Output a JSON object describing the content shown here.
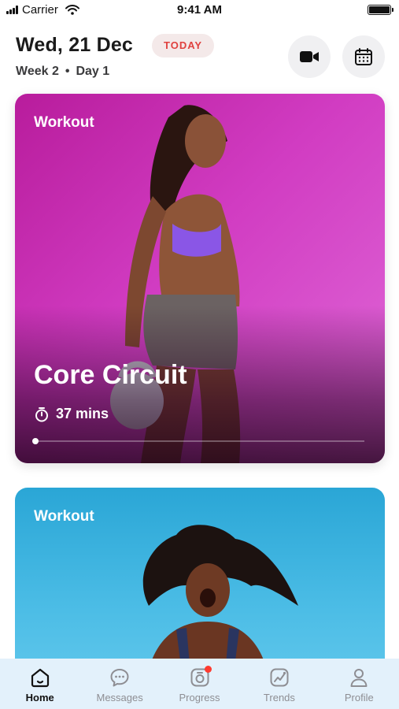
{
  "status_bar": {
    "carrier": "Carrier",
    "time": "9:41 AM"
  },
  "header": {
    "date": "Wed, 21 Dec",
    "badge": "TODAY",
    "week": "Week 2",
    "separator": "•",
    "day": "Day 1",
    "icons": [
      "video-camera-icon",
      "calendar-icon"
    ]
  },
  "cards": [
    {
      "category": "Workout",
      "title": "Core Circuit",
      "duration": "37 mins",
      "progress": 0.0
    },
    {
      "category": "Workout"
    }
  ],
  "tabs": [
    {
      "label": "Home",
      "icon": "home-icon",
      "active": true
    },
    {
      "label": "Messages",
      "icon": "messages-icon"
    },
    {
      "label": "Progress",
      "icon": "progress-icon",
      "has_notification": true
    },
    {
      "label": "Trends",
      "icon": "trends-icon"
    },
    {
      "label": "Profile",
      "icon": "profile-icon"
    }
  ],
  "colors": {
    "badge_text": "#e0413f",
    "badge_bg": "#f4e9e9",
    "card1_bg": "#c92fb5",
    "card2_bg": "#3fb2e0",
    "tab_bar_bg": "#e3f1fb",
    "notification": "#ff3b30"
  }
}
